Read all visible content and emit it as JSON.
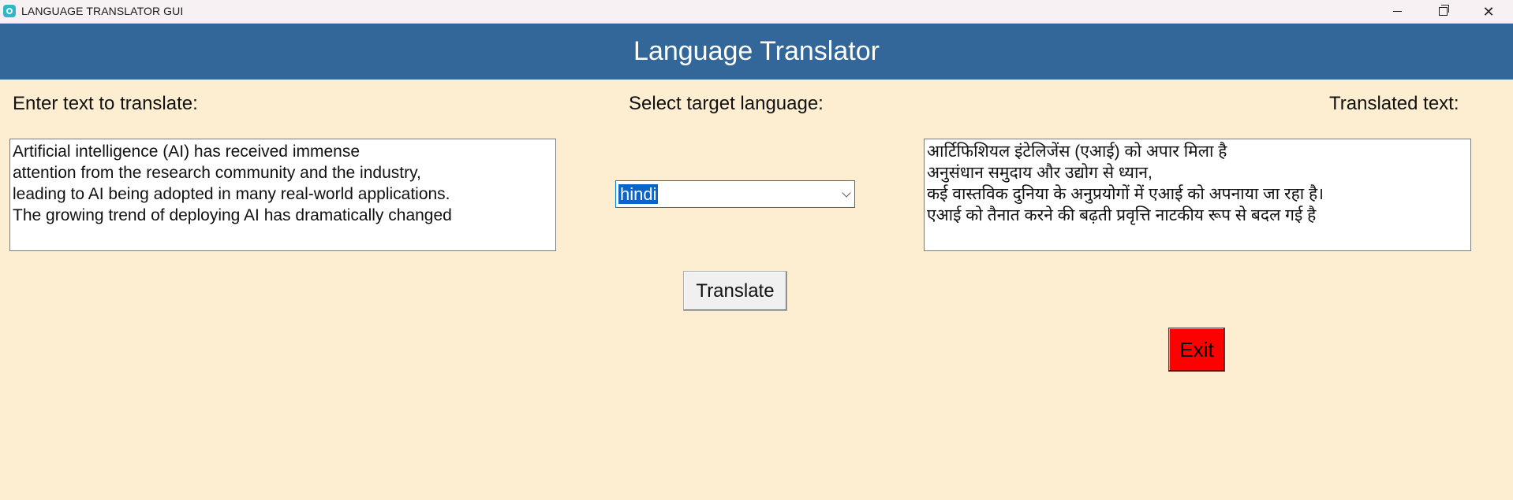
{
  "window": {
    "title": "LANGUAGE TRANSLATOR GUI",
    "controls": {
      "minimize": "minimize",
      "maximize": "restore",
      "close": "close"
    }
  },
  "header": {
    "title": "Language Translator"
  },
  "source": {
    "label": "Enter text to translate:",
    "text": "Artificial intelligence (AI) has received immense\nattention from the research community and the industry,\nleading to AI being adopted in many real-world applications.\nThe growing trend of deploying AI has dramatically changed"
  },
  "target": {
    "label": "Select target language:",
    "selected": "hindi"
  },
  "output": {
    "label": "Translated text:",
    "text": "आर्टिफिशियल इंटेलिजेंस (एआई) को अपार मिला है\nअनुसंधान समुदाय और उद्योग से ध्यान,\nकई वास्तविक दुनिया के अनुप्रयोगों में एआई को अपनाया जा रहा है।\nएआई को तैनात करने की बढ़ती प्रवृत्ति नाटकीय रूप से बदल गई है"
  },
  "buttons": {
    "translate": "Translate",
    "exit": "Exit"
  },
  "colors": {
    "header_bg": "#336699",
    "window_bg": "#fdeed1",
    "exit_bg": "#ff0000",
    "selection": "#0a64cc"
  }
}
